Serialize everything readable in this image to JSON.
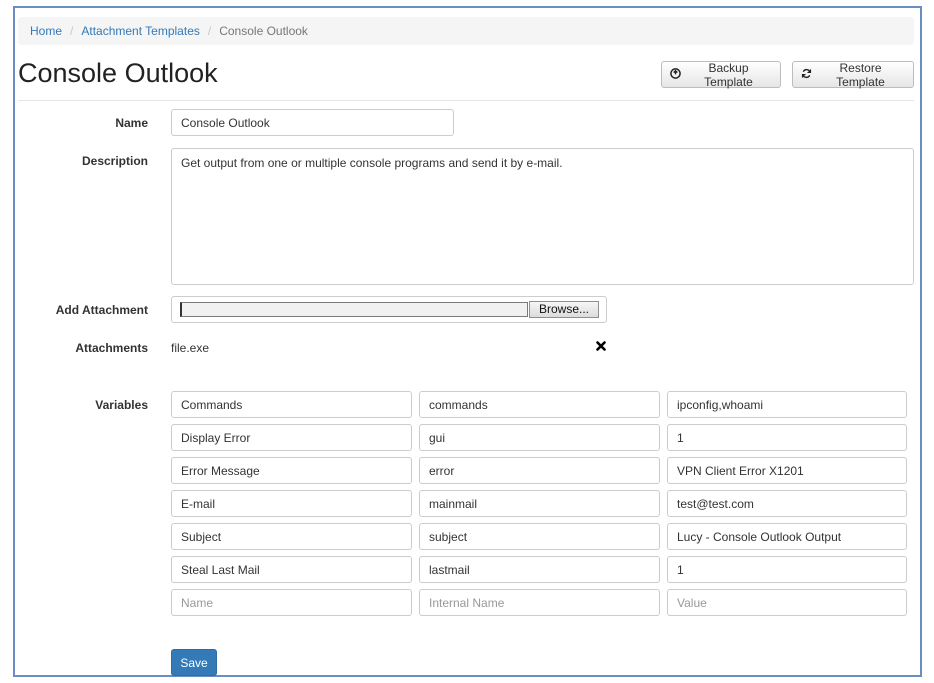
{
  "breadcrumb": {
    "items": [
      "Home",
      "Attachment Templates"
    ],
    "separator": "/",
    "active": "Console Outlook"
  },
  "page": {
    "title": "Console Outlook"
  },
  "header_buttons": {
    "backup": {
      "label": "Backup Template",
      "icon": "arrow-circle-icon"
    },
    "restore": {
      "label": "Restore Template",
      "icon": "refresh-icon"
    }
  },
  "form": {
    "name_label": "Name",
    "name_value": "Console Outlook",
    "description_label": "Description",
    "description_value": "Get output from one or multiple console programs and send it by e-mail.",
    "add_attachment_label": "Add Attachment",
    "browse_label": "Browse...",
    "attachments_label": "Attachments",
    "attachments": [
      {
        "name": "file.exe",
        "delete_icon": "close-icon"
      }
    ],
    "variables_label": "Variables",
    "variables": [
      {
        "name": "Commands",
        "internal": "commands",
        "value": "ipconfig,whoami"
      },
      {
        "name": "Display Error",
        "internal": "gui",
        "value": "1"
      },
      {
        "name": "Error Message",
        "internal": "error",
        "value": "VPN Client Error X1201"
      },
      {
        "name": "E-mail",
        "internal": "mainmail",
        "value": "test@test.com"
      },
      {
        "name": "Subject",
        "internal": "subject",
        "value": "Lucy - Console Outlook Output"
      },
      {
        "name": "Steal Last Mail",
        "internal": "lastmail",
        "value": "1"
      }
    ],
    "new_variable_placeholders": {
      "name": "Name",
      "internal": "Internal Name",
      "value": "Value"
    },
    "save_label": "Save"
  },
  "colors": {
    "link": "#337ab7",
    "primary": "#337ab7",
    "frame_border": "#6a8ec1"
  }
}
